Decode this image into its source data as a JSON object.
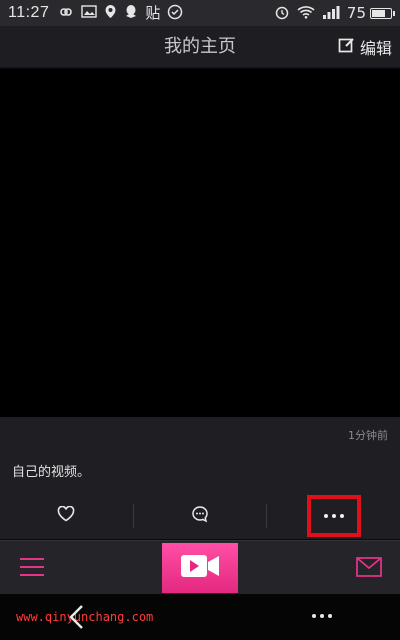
{
  "status_bar": {
    "time": "11:27",
    "left_icons": [
      "infinity-icon",
      "image-icon",
      "location-icon",
      "qq-icon"
    ],
    "tie_label": "贴",
    "check_icon": "check-circle-icon",
    "right_icons": [
      "alarm-icon",
      "wifi-icon",
      "signal-icon"
    ],
    "battery_level": "75",
    "battery_fraction": 0.75
  },
  "header": {
    "title": "我的主页",
    "edit_label": "编辑",
    "edit_icon": "edit-icon"
  },
  "post": {
    "time_ago": "1分钟前",
    "caption": "自己的视频。",
    "actions": {
      "like_icon": "heart-icon",
      "comment_icon": "comment-icon",
      "more_icon": "more-icon"
    }
  },
  "tab_bar": {
    "menu_icon": "menu-icon",
    "record_icon": "video-camera-icon",
    "mail_icon": "mail-icon",
    "accent_color": "#e6348a"
  },
  "system_nav": {
    "back_icon": "back-icon",
    "more_icon": "more-icon"
  },
  "watermark": "www.qinyunchang.com",
  "colors": {
    "highlight": "#e0101a",
    "record_gradient_top": "#ff4fa6",
    "record_gradient_bottom": "#e4287f"
  }
}
